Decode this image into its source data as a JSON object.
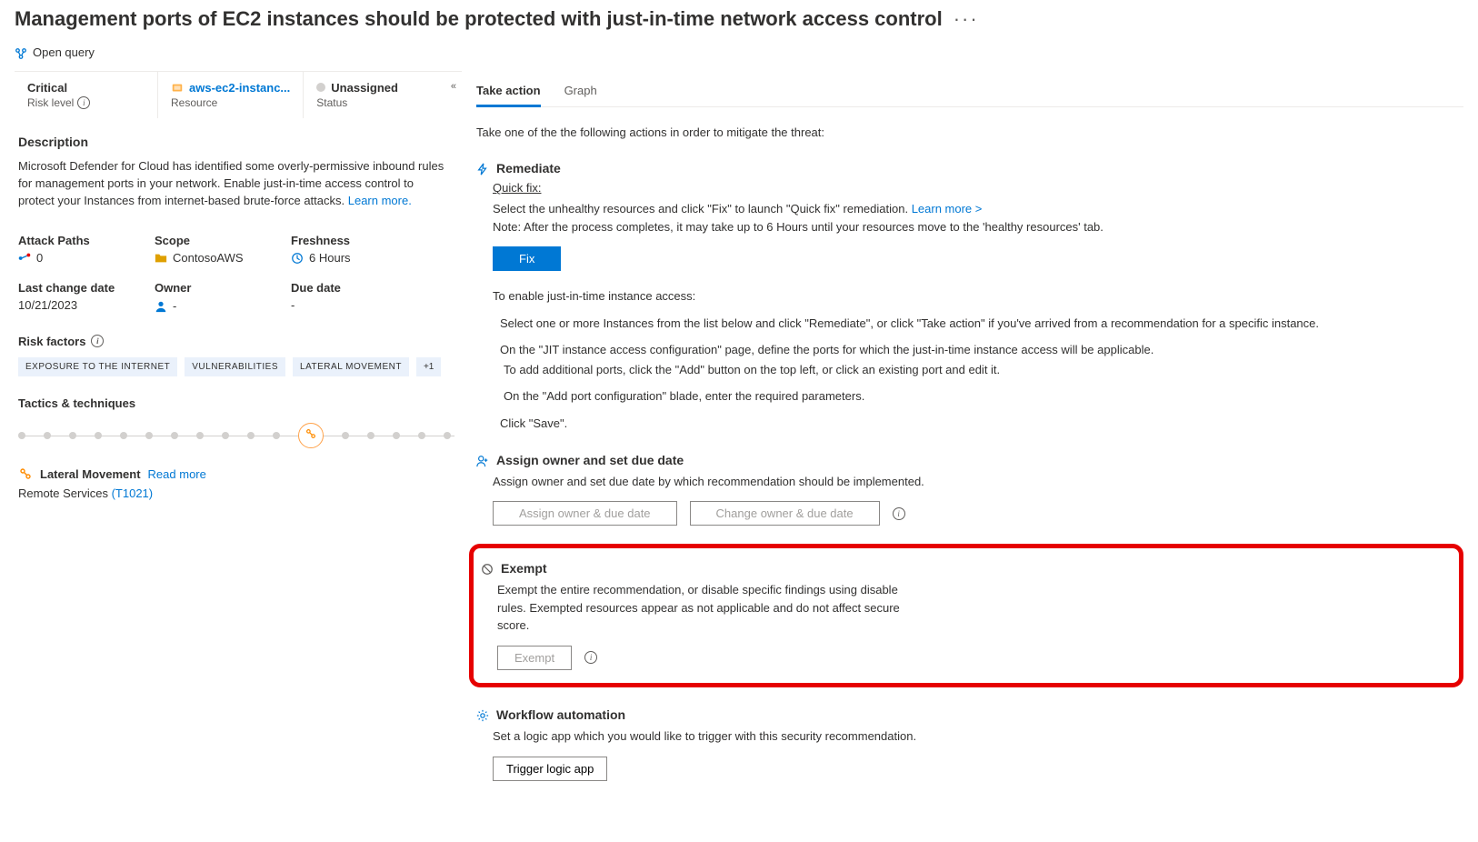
{
  "page": {
    "title": "Management ports of EC2 instances should be protected with just-in-time network access control",
    "open_query": "Open query"
  },
  "info_bar": {
    "risk_level": {
      "value": "Critical",
      "label": "Risk level"
    },
    "resource": {
      "value": "aws-ec2-instanc...",
      "label": "Resource"
    },
    "status": {
      "value": "Unassigned",
      "label": "Status"
    }
  },
  "description": {
    "heading": "Description",
    "text": "Microsoft Defender for Cloud has identified some overly-permissive inbound rules for management ports in your network. Enable just-in-time access control to protect your Instances from internet-based brute-force attacks. ",
    "learn_more": "Learn more."
  },
  "meta": {
    "attack_paths": {
      "label": "Attack Paths",
      "value": "0"
    },
    "scope": {
      "label": "Scope",
      "value": "ContosoAWS"
    },
    "freshness": {
      "label": "Freshness",
      "value": "6 Hours"
    },
    "last_change": {
      "label": "Last change date",
      "value": "10/21/2023"
    },
    "owner": {
      "label": "Owner",
      "value": "-"
    },
    "due_date": {
      "label": "Due date",
      "value": "-"
    }
  },
  "risk_factors": {
    "label": "Risk factors",
    "chips": [
      "EXPOSURE TO THE INTERNET",
      "VULNERABILITIES",
      "LATERAL MOVEMENT"
    ],
    "more": "+1"
  },
  "tactics": {
    "label": "Tactics & techniques"
  },
  "lateral": {
    "title": "Lateral Movement",
    "read_more": "Read more",
    "sub_prefix": "Remote Services ",
    "tcode": "(T1021)"
  },
  "tabs": {
    "take_action": "Take action",
    "graph": "Graph"
  },
  "right": {
    "intro": "Take one of the the following actions in order to mitigate the threat:",
    "remediate": {
      "title": "Remediate",
      "quickfix_label": "Quick fix:",
      "line1_prefix": "Select the unhealthy resources and click \"Fix\" to launch \"Quick fix\" remediation. ",
      "learn_more": "Learn more >",
      "line2": "Note: After the process completes, it may take up to 6 Hours until your resources move to the 'healthy resources' tab.",
      "fix_btn": "Fix",
      "enable_intro": "To enable just-in-time instance access:",
      "step1": "Select one or more Instances from the list below and click \"Remediate\", or click \"Take action\" if you've arrived from a recommendation for a specific instance.",
      "step2a": "On the \"JIT instance access configuration\" page, define the ports for which the just-in-time instance access will be applicable.",
      "step2b": "To add additional ports, click the \"Add\" button on the top left, or click an existing port and edit it.",
      "step3": "On the \"Add port configuration\" blade, enter the required parameters.",
      "step4": "Click \"Save\"."
    },
    "assign": {
      "title": "Assign owner and set due date",
      "desc": "Assign owner and set due date by which recommendation should be implemented.",
      "btn1": "Assign owner & due date",
      "btn2": "Change owner & due date"
    },
    "exempt": {
      "title": "Exempt",
      "desc": "Exempt the entire recommendation, or disable specific findings using disable rules. Exempted resources appear as not applicable and do not affect secure score.",
      "btn": "Exempt"
    },
    "workflow": {
      "title": "Workflow automation",
      "desc": "Set a logic app which you would like to trigger with this security recommendation.",
      "btn": "Trigger logic app"
    }
  }
}
